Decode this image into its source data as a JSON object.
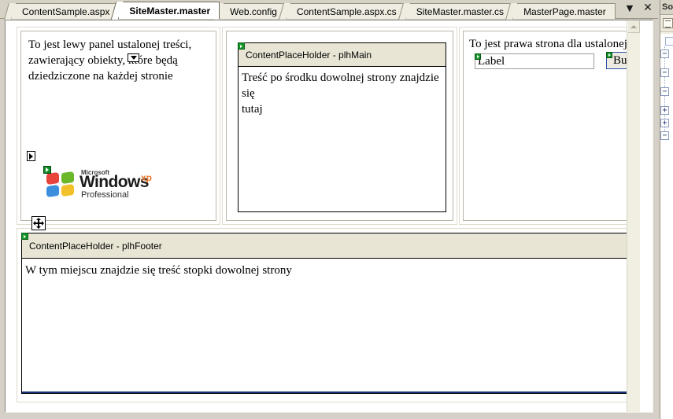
{
  "tabstrip": {
    "tabs": [
      {
        "label": "ContentSample.aspx",
        "active": false
      },
      {
        "label": "SiteMaster.master",
        "active": true
      },
      {
        "label": "Web.config",
        "active": false
      },
      {
        "label": "ContentSample.aspx.cs",
        "active": false
      },
      {
        "label": "SiteMaster.master.cs",
        "active": false
      },
      {
        "label": "MasterPage.master",
        "active": false
      }
    ],
    "tools": {
      "dropdown_label": "▼",
      "close_label": "✕"
    }
  },
  "designer": {
    "left_pane": {
      "paragraph_line1": "To jest lewy panel ustalonej treści,",
      "paragraph_line2": "zawierający obiekty, które będą",
      "paragraph_line3": "dziedziczone na każdej stronie",
      "logo": {
        "brand": "Microsoft",
        "product": "Windows",
        "version": "xp",
        "edition": "Professional"
      }
    },
    "center_pane": {
      "placeholder_title": "ContentPlaceHolder - plhMain",
      "body_line1": "Treść po środku dowolnej strony znajdzie się",
      "body_line2": "tutaj"
    },
    "right_pane": {
      "paragraph": "To jest prawa strona dla ustalonej treści",
      "label_value": "Label",
      "button_label": "Button"
    },
    "footer_pane": {
      "placeholder_title": "ContentPlaceHolder - plhFooter",
      "body_line1": "W tym miejscu znajdzie się treść stopki dowolnej strony"
    }
  },
  "right_dock": {
    "title": "So"
  },
  "colors": {
    "placeholder_header_bg": "#e8e5d5",
    "tab_active_bg": "#ffffff",
    "tab_inactive_bg": "#efece1",
    "chrome_bg": "#d6d3c6",
    "footer_rule": "#16347d",
    "control_tag_green": "#16962b",
    "button_border_blue": "#2c52a8",
    "xp_orange": "#e8762a"
  }
}
